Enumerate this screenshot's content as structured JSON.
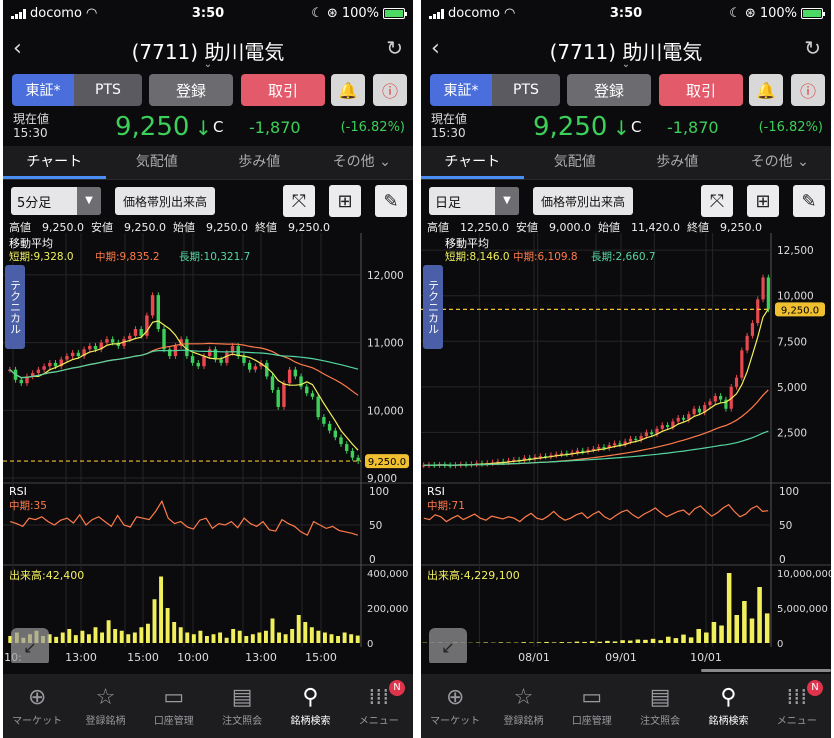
{
  "status": {
    "carrier": "docomo",
    "time": "3:50",
    "battery": "100%"
  },
  "header": {
    "title": "(7711) 助川電気"
  },
  "toolbar": {
    "tse": "東証*",
    "pts": "PTS",
    "register": "登録",
    "trade": "取引"
  },
  "price": {
    "label": "現在値",
    "time": "15:30",
    "value": "9,250",
    "arrow": "↓",
    "flag": "C",
    "change": "-1,870",
    "pct": "(-16.82%)"
  },
  "tabs": [
    "チャート",
    "気配値",
    "歩み値",
    "その他 ⌄"
  ],
  "volume_profile_label": "価格帯別出来高",
  "bottom_tabs": [
    {
      "icon": "globe-icon",
      "label": "マーケット"
    },
    {
      "icon": "star-icon",
      "label": "登録銘柄"
    },
    {
      "icon": "card-icon",
      "label": "口座管理"
    },
    {
      "icon": "document-icon",
      "label": "注文照会"
    },
    {
      "icon": "search-icon",
      "label": "銘柄検索"
    },
    {
      "icon": "grid-icon",
      "label": "メニュー",
      "badge": "N"
    }
  ],
  "colors": {
    "up": "#e8494e",
    "down": "#3ccf5a",
    "short": "#f1ef5b",
    "mid": "#ff7b4a",
    "long": "#55d6a0",
    "rsi": "#ff7b4a",
    "volume": "#f1ef5b",
    "current": "#f0c030",
    "tab_active": "#4a8ef5"
  },
  "left": {
    "period": "5分足",
    "ohlc": {
      "high": "高値　9,250.0",
      "low": "安値　9,250.0",
      "open": "始値　9,250.0",
      "close": "終値　9,250.0"
    },
    "ma_title": "移動平均",
    "ma_short": "短期:9,328.0",
    "ma_mid": "中期:9,835.2",
    "ma_long": "長期:10,321.7",
    "technical": "テクニカル",
    "current_label": "9,250.0",
    "price_ticks": [
      "12,000",
      "11,000",
      "10,000",
      "9,000"
    ],
    "rsi_label": "RSI",
    "rsi_value": "中期:35",
    "rsi_ticks": [
      "100",
      "50",
      "0"
    ],
    "vol_label": "出来高:42,400",
    "vol_ticks": [
      "400,000",
      "200,000",
      "0"
    ],
    "time_ticks": [
      "10:",
      "13:00",
      "15:00",
      "10:00",
      "13:00",
      "15:00"
    ]
  },
  "right": {
    "period": "日足",
    "ohlc": {
      "high": "高値　12,250.0",
      "low": "安値　9,000.0",
      "open": "始値　11,420.0",
      "close": "終値　9,250.0"
    },
    "ma_title": "移動平均",
    "ma_short": "短期:8,146.0",
    "ma_mid": "中期:6,109.8",
    "ma_long": "長期:2,660.7",
    "technical": "テクニカル",
    "current_label": "9,250.0",
    "price_ticks": [
      "12,500",
      "10,000",
      "7,500",
      "5,000",
      "2,500"
    ],
    "rsi_label": "RSI",
    "rsi_value": "中期:71",
    "rsi_ticks": [
      "100",
      "50",
      "0"
    ],
    "vol_label": "出来高:4,229,100",
    "vol_ticks": [
      "10,000,000",
      "5,000,000",
      "0"
    ],
    "time_ticks": [
      "08/01",
      "09/01",
      "10/01"
    ]
  },
  "chart_data": [
    {
      "type": "candlestick",
      "interval": "5分足",
      "ylim": [
        9000,
        12500
      ],
      "current": 9250,
      "close": [
        10600,
        10450,
        10400,
        10500,
        10550,
        10600,
        10650,
        10700,
        10650,
        10750,
        10800,
        10850,
        10800,
        10900,
        10950,
        10900,
        11000,
        11050,
        11000,
        10950,
        11050,
        11100,
        11200,
        11100,
        11400,
        11700,
        11200,
        10900,
        10800,
        10950,
        11050,
        10800,
        10700,
        10650,
        10800,
        10900,
        10750,
        10700,
        10850,
        10950,
        10800,
        10700,
        10600,
        10650,
        10700,
        10500,
        10300,
        10050,
        10400,
        10600,
        10500,
        10350,
        10250,
        10200,
        9900,
        9800,
        9700,
        9600,
        9500,
        9400,
        9300,
        9250
      ],
      "rsi": [
        55,
        52,
        48,
        60,
        58,
        62,
        55,
        50,
        57,
        60,
        53,
        65,
        50,
        58,
        62,
        55,
        48,
        64,
        50,
        47,
        62,
        60,
        58,
        70,
        85,
        60,
        52,
        55,
        47,
        44,
        57,
        60,
        45,
        52,
        50,
        55,
        46,
        60,
        52,
        48,
        55,
        43,
        41,
        58,
        52,
        48,
        40,
        35,
        55,
        50,
        45,
        48,
        42,
        40,
        38,
        35
      ],
      "volume": [
        40000,
        60000,
        30000,
        50000,
        70000,
        40000,
        50000,
        35000,
        60000,
        80000,
        45000,
        70000,
        50000,
        90000,
        60000,
        130000,
        80000,
        70000,
        50000,
        60000,
        90000,
        110000,
        250000,
        380000,
        200000,
        120000,
        90000,
        60000,
        50000,
        70000,
        40000,
        50000,
        60000,
        30000,
        80000,
        70000,
        40000,
        50000,
        60000,
        70000,
        140000,
        60000,
        50000,
        80000,
        160000,
        120000,
        90000,
        70000,
        60000,
        50000,
        40000,
        60000,
        50000,
        42400
      ]
    },
    {
      "type": "candlestick",
      "interval": "日足",
      "ylim": [
        0,
        13000
      ],
      "current": 9250,
      "close": [
        700,
        720,
        710,
        730,
        700,
        690,
        720,
        740,
        730,
        760,
        800,
        780,
        820,
        850,
        900,
        870,
        950,
        1000,
        980,
        1100,
        1050,
        1150,
        1200,
        1180,
        1250,
        1300,
        1350,
        1320,
        1400,
        1500,
        1450,
        1550,
        1600,
        1700,
        1650,
        1800,
        1900,
        1850,
        2000,
        2150,
        2100,
        2300,
        2500,
        2400,
        2700,
        2900,
        2800,
        3100,
        3300,
        3200,
        3500,
        3800,
        3600,
        4000,
        4200,
        4500,
        4300,
        3800,
        5000,
        5500,
        7000,
        7800,
        8500,
        9800,
        11000,
        9250
      ],
      "rsi": [
        60,
        58,
        65,
        62,
        55,
        60,
        64,
        58,
        62,
        66,
        60,
        57,
        63,
        61,
        59,
        62,
        60,
        55,
        62,
        67,
        60,
        58,
        63,
        70,
        62,
        57,
        60,
        65,
        68,
        60,
        66,
        70,
        62,
        58,
        64,
        69,
        72,
        65,
        60,
        66,
        70,
        75,
        68,
        62,
        66,
        70,
        72,
        65,
        74,
        78,
        70,
        63,
        68,
        75,
        80,
        70,
        62,
        66,
        74,
        78,
        70,
        71
      ],
      "volume": [
        50000,
        40000,
        60000,
        30000,
        70000,
        50000,
        40000,
        60000,
        80000,
        50000,
        90000,
        70000,
        60000,
        120000,
        80000,
        100000,
        150000,
        90000,
        130000,
        110000,
        200000,
        150000,
        250000,
        180000,
        300000,
        220000,
        400000,
        350000,
        500000,
        450000,
        600000,
        400000,
        900000,
        700000,
        1200000,
        800000,
        2000000,
        1500000,
        3000000,
        2500000,
        10000000,
        4000000,
        6000000,
        3500000,
        8000000,
        4229100
      ]
    }
  ]
}
